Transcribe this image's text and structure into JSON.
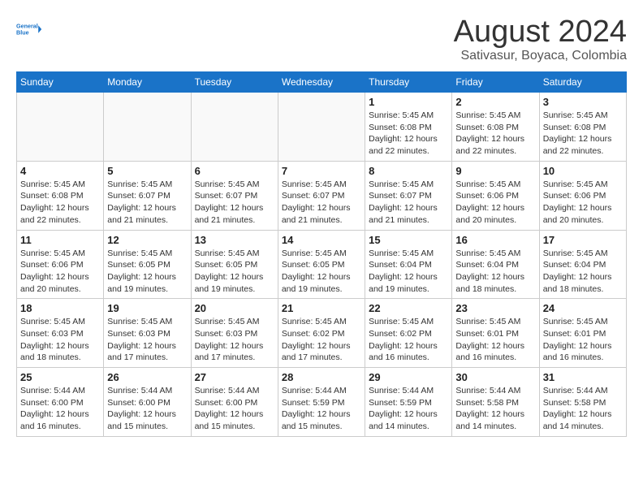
{
  "header": {
    "logo_line1": "General",
    "logo_line2": "Blue",
    "month_year": "August 2024",
    "location": "Sativasur, Boyaca, Colombia"
  },
  "days_of_week": [
    "Sunday",
    "Monday",
    "Tuesday",
    "Wednesday",
    "Thursday",
    "Friday",
    "Saturday"
  ],
  "weeks": [
    {
      "days": [
        {
          "number": "",
          "info": ""
        },
        {
          "number": "",
          "info": ""
        },
        {
          "number": "",
          "info": ""
        },
        {
          "number": "",
          "info": ""
        },
        {
          "number": "1",
          "info": "Sunrise: 5:45 AM\nSunset: 6:08 PM\nDaylight: 12 hours\nand 22 minutes."
        },
        {
          "number": "2",
          "info": "Sunrise: 5:45 AM\nSunset: 6:08 PM\nDaylight: 12 hours\nand 22 minutes."
        },
        {
          "number": "3",
          "info": "Sunrise: 5:45 AM\nSunset: 6:08 PM\nDaylight: 12 hours\nand 22 minutes."
        }
      ]
    },
    {
      "days": [
        {
          "number": "4",
          "info": "Sunrise: 5:45 AM\nSunset: 6:08 PM\nDaylight: 12 hours\nand 22 minutes."
        },
        {
          "number": "5",
          "info": "Sunrise: 5:45 AM\nSunset: 6:07 PM\nDaylight: 12 hours\nand 21 minutes."
        },
        {
          "number": "6",
          "info": "Sunrise: 5:45 AM\nSunset: 6:07 PM\nDaylight: 12 hours\nand 21 minutes."
        },
        {
          "number": "7",
          "info": "Sunrise: 5:45 AM\nSunset: 6:07 PM\nDaylight: 12 hours\nand 21 minutes."
        },
        {
          "number": "8",
          "info": "Sunrise: 5:45 AM\nSunset: 6:07 PM\nDaylight: 12 hours\nand 21 minutes."
        },
        {
          "number": "9",
          "info": "Sunrise: 5:45 AM\nSunset: 6:06 PM\nDaylight: 12 hours\nand 20 minutes."
        },
        {
          "number": "10",
          "info": "Sunrise: 5:45 AM\nSunset: 6:06 PM\nDaylight: 12 hours\nand 20 minutes."
        }
      ]
    },
    {
      "days": [
        {
          "number": "11",
          "info": "Sunrise: 5:45 AM\nSunset: 6:06 PM\nDaylight: 12 hours\nand 20 minutes."
        },
        {
          "number": "12",
          "info": "Sunrise: 5:45 AM\nSunset: 6:05 PM\nDaylight: 12 hours\nand 19 minutes."
        },
        {
          "number": "13",
          "info": "Sunrise: 5:45 AM\nSunset: 6:05 PM\nDaylight: 12 hours\nand 19 minutes."
        },
        {
          "number": "14",
          "info": "Sunrise: 5:45 AM\nSunset: 6:05 PM\nDaylight: 12 hours\nand 19 minutes."
        },
        {
          "number": "15",
          "info": "Sunrise: 5:45 AM\nSunset: 6:04 PM\nDaylight: 12 hours\nand 19 minutes."
        },
        {
          "number": "16",
          "info": "Sunrise: 5:45 AM\nSunset: 6:04 PM\nDaylight: 12 hours\nand 18 minutes."
        },
        {
          "number": "17",
          "info": "Sunrise: 5:45 AM\nSunset: 6:04 PM\nDaylight: 12 hours\nand 18 minutes."
        }
      ]
    },
    {
      "days": [
        {
          "number": "18",
          "info": "Sunrise: 5:45 AM\nSunset: 6:03 PM\nDaylight: 12 hours\nand 18 minutes."
        },
        {
          "number": "19",
          "info": "Sunrise: 5:45 AM\nSunset: 6:03 PM\nDaylight: 12 hours\nand 17 minutes."
        },
        {
          "number": "20",
          "info": "Sunrise: 5:45 AM\nSunset: 6:03 PM\nDaylight: 12 hours\nand 17 minutes."
        },
        {
          "number": "21",
          "info": "Sunrise: 5:45 AM\nSunset: 6:02 PM\nDaylight: 12 hours\nand 17 minutes."
        },
        {
          "number": "22",
          "info": "Sunrise: 5:45 AM\nSunset: 6:02 PM\nDaylight: 12 hours\nand 16 minutes."
        },
        {
          "number": "23",
          "info": "Sunrise: 5:45 AM\nSunset: 6:01 PM\nDaylight: 12 hours\nand 16 minutes."
        },
        {
          "number": "24",
          "info": "Sunrise: 5:45 AM\nSunset: 6:01 PM\nDaylight: 12 hours\nand 16 minutes."
        }
      ]
    },
    {
      "days": [
        {
          "number": "25",
          "info": "Sunrise: 5:44 AM\nSunset: 6:00 PM\nDaylight: 12 hours\nand 16 minutes."
        },
        {
          "number": "26",
          "info": "Sunrise: 5:44 AM\nSunset: 6:00 PM\nDaylight: 12 hours\nand 15 minutes."
        },
        {
          "number": "27",
          "info": "Sunrise: 5:44 AM\nSunset: 6:00 PM\nDaylight: 12 hours\nand 15 minutes."
        },
        {
          "number": "28",
          "info": "Sunrise: 5:44 AM\nSunset: 5:59 PM\nDaylight: 12 hours\nand 15 minutes."
        },
        {
          "number": "29",
          "info": "Sunrise: 5:44 AM\nSunset: 5:59 PM\nDaylight: 12 hours\nand 14 minutes."
        },
        {
          "number": "30",
          "info": "Sunrise: 5:44 AM\nSunset: 5:58 PM\nDaylight: 12 hours\nand 14 minutes."
        },
        {
          "number": "31",
          "info": "Sunrise: 5:44 AM\nSunset: 5:58 PM\nDaylight: 12 hours\nand 14 minutes."
        }
      ]
    }
  ]
}
